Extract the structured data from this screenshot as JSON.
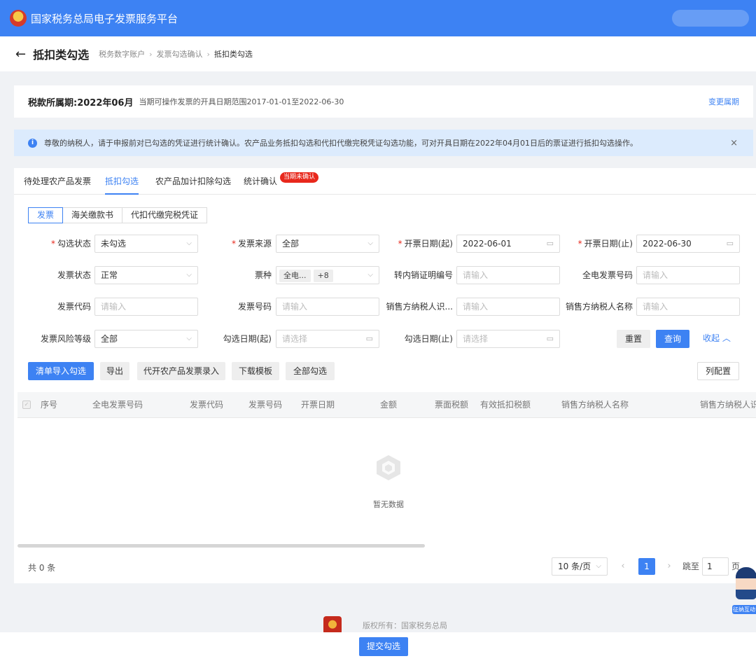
{
  "app": {
    "title": "国家税务总局电子发票服务平台"
  },
  "header": {
    "page_title": "抵扣类勾选",
    "breadcrumb": [
      "税务数字账户",
      "发票勾选确认",
      "抵扣类勾选"
    ]
  },
  "period": {
    "label": "税款所属期:",
    "value": "2022年06月",
    "note": "当期可操作发票的开具日期范围2017-01-01至2022-06-30",
    "change_link": "变更属期"
  },
  "notice": {
    "text": "尊敬的纳税人，请于申报前对已勾选的凭证进行统计确认。农产品业务抵扣勾选和代扣代缴完税凭证勾选功能，可对开具日期在2022年04月01日后的票证进行抵扣勾选操作。",
    "close": "×"
  },
  "tabs": [
    {
      "label": "待处理农产品发票"
    },
    {
      "label": "抵扣勾选"
    },
    {
      "label": "农产品加计扣除勾选"
    },
    {
      "label": "统计确认"
    }
  ],
  "tab_badge": "当期未确认",
  "subtabs": [
    "发票",
    "海关缴款书",
    "代扣代缴完税凭证"
  ],
  "form": {
    "check_status": {
      "label": "勾选状态",
      "value": "未勾选"
    },
    "invoice_source": {
      "label": "发票来源",
      "value": "全部"
    },
    "issue_date_start": {
      "label": "开票日期(起)",
      "value": "2022-06-01"
    },
    "issue_date_end": {
      "label": "开票日期(止)",
      "value": "2022-06-30"
    },
    "invoice_status": {
      "label": "发票状态",
      "value": "正常"
    },
    "invoice_type": {
      "label": "票种",
      "tag": "全电...",
      "more": "+8"
    },
    "transfer_no": {
      "label": "转内销证明编号",
      "placeholder": "请输入"
    },
    "full_invoice_no": {
      "label": "全电发票号码",
      "placeholder": "请输入"
    },
    "invoice_code": {
      "label": "发票代码",
      "placeholder": "请输入"
    },
    "invoice_no": {
      "label": "发票号码",
      "placeholder": "请输入"
    },
    "seller_tax_id": {
      "label": "销售方纳税人识...",
      "placeholder": "请输入"
    },
    "seller_name": {
      "label": "销售方纳税人名称",
      "placeholder": "请输入"
    },
    "risk_level": {
      "label": "发票风险等级",
      "value": "全部"
    },
    "check_date_start": {
      "label": "勾选日期(起)",
      "placeholder": "请选择"
    },
    "check_date_end": {
      "label": "勾选日期(止)",
      "placeholder": "请选择"
    },
    "reset": "重置",
    "query": "查询",
    "collapse": "收起"
  },
  "actions": {
    "import_check": "清单导入勾选",
    "export": "导出",
    "agri_entry": "代开农产品发票录入",
    "download_template": "下载模板",
    "check_all": "全部勾选",
    "column_config": "列配置"
  },
  "table": {
    "columns": [
      "序号",
      "全电发票号码",
      "发票代码",
      "发票号码",
      "开票日期",
      "金额",
      "票面税额",
      "有效抵扣税额",
      "销售方纳税人名称",
      "销售方纳税人识"
    ],
    "empty_text": "暂无数据"
  },
  "pagination": {
    "total": "共 0 条",
    "page_size": "10 条/页",
    "current": "1",
    "jump_label": "跳至",
    "jump_value": "1",
    "page_unit": "页"
  },
  "footer": {
    "copyright": "版权所有：国家税务总局"
  },
  "submit": "提交勾选",
  "assistant": {
    "label": "征纳互动"
  }
}
